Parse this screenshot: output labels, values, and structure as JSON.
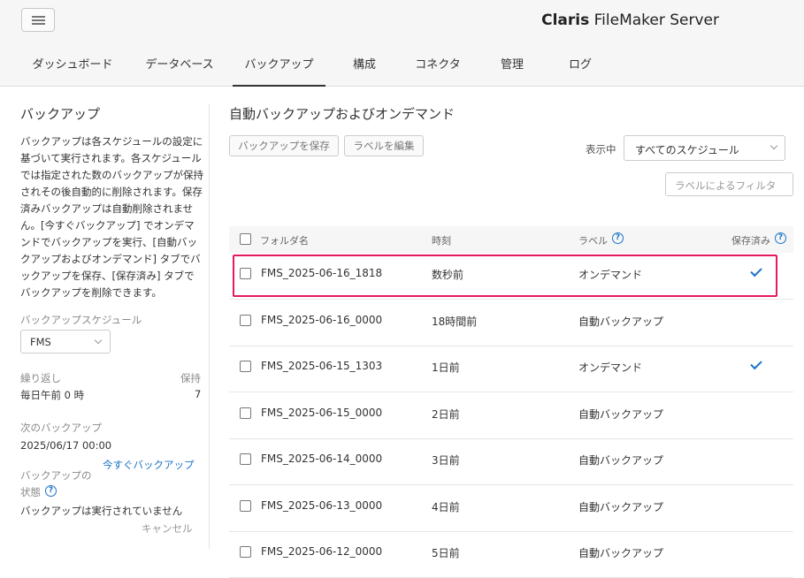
{
  "brand": {
    "bold": "Claris",
    "rest": " FileMaker Server"
  },
  "tabs": [
    {
      "label": "ダッシュボード"
    },
    {
      "label": "データベース"
    },
    {
      "label": "バックアップ"
    },
    {
      "label": "構成"
    },
    {
      "label": "コネクタ"
    },
    {
      "label": "管理"
    },
    {
      "label": "ログ"
    }
  ],
  "sidebar": {
    "title": "バックアップ",
    "description": "バックアップは各スケジュールの設定に基づいて実行されます。各スケジュールでは指定された数のバックアップが保持されその後自動的に削除されます。保存済みバックアップは自動削除されません。[今すぐバックアップ] でオンデマンドでバックアップを実行、[自動バックアップおよびオンデマンド] タブでバックアップを保存、[保存済み] タブでバックアップを削除できます。",
    "schedule_label": "バックアップスケジュール",
    "schedule_value": "FMS",
    "repeat_label": "繰り返し",
    "keep_label": "保持",
    "repeat_value": "毎日午前 0 時",
    "keep_value": "7",
    "next_label": "次のバックアップ",
    "next_value": "2025/06/17 00:00",
    "status_label_1": "バックアップの",
    "status_label_2": "状態",
    "backup_now": "今すぐバックアップ",
    "status_value": "バックアップは実行されていません",
    "cancel": "キャンセル"
  },
  "main": {
    "title": "自動バックアップおよびオンデマンド",
    "save_button": "バックアップを保存",
    "edit_label_button": "ラベルを編集",
    "show_label": "表示中",
    "schedule_select": "すべてのスケジュール",
    "filter_placeholder": "ラベルによるフィルタ",
    "columns": {
      "folder": "フォルダ名",
      "time": "時刻",
      "label": "ラベル",
      "saved": "保存済み"
    },
    "rows": [
      {
        "folder": "FMS_2025-06-16_1818",
        "time": "数秒前",
        "label": "オンデマンド",
        "saved": true
      },
      {
        "folder": "FMS_2025-06-16_0000",
        "time": "18時間前",
        "label": "自動バックアップ",
        "saved": false
      },
      {
        "folder": "FMS_2025-06-15_1303",
        "time": "1日前",
        "label": "オンデマンド",
        "saved": true
      },
      {
        "folder": "FMS_2025-06-15_0000",
        "time": "2日前",
        "label": "自動バックアップ",
        "saved": false
      },
      {
        "folder": "FMS_2025-06-14_0000",
        "time": "3日前",
        "label": "自動バックアップ",
        "saved": false
      },
      {
        "folder": "FMS_2025-06-13_0000",
        "time": "4日前",
        "label": "自動バックアップ",
        "saved": false
      },
      {
        "folder": "FMS_2025-06-12_0000",
        "time": "5日前",
        "label": "自動バックアップ",
        "saved": false
      }
    ]
  },
  "colors": {
    "accent": "#1a73c8",
    "highlight": "#e5195e"
  }
}
